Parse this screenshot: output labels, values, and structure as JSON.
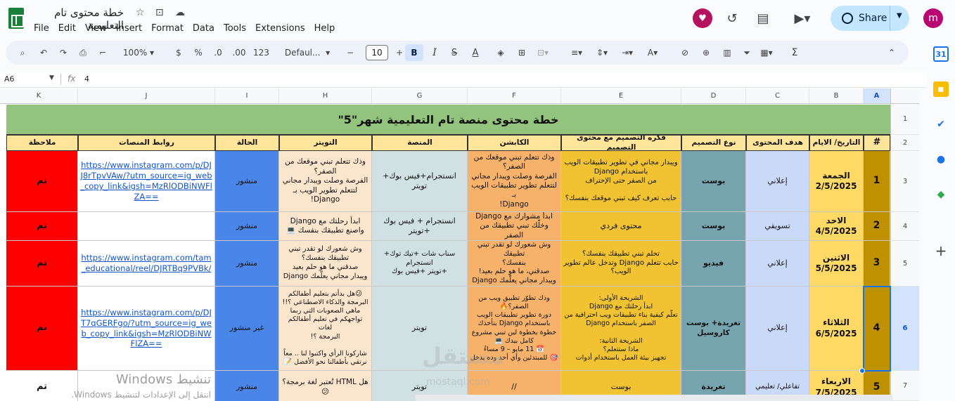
{
  "app": {
    "doc_title": "خطة محتوى تام التعليمية",
    "menu": [
      "File",
      "Edit",
      "View",
      "Insert",
      "Format",
      "Data",
      "Tools",
      "Extensions",
      "Help"
    ],
    "share_label": "Share",
    "avatar_letter": "m"
  },
  "toolbar": {
    "zoom": "100%",
    "currency": "$",
    "percent": "%",
    "dec_less": ".0",
    "dec_more": ".00",
    "number_format": "123",
    "font": "Defaul...",
    "font_size": "10",
    "bold": "B",
    "italic": "I",
    "strike": "S",
    "text_color": "A",
    "sum": "Σ"
  },
  "formula_bar": {
    "cell_ref": "A6",
    "fx": "fx",
    "value": "4"
  },
  "columns": [
    "K",
    "J",
    "I",
    "H",
    "G",
    "F",
    "E",
    "D",
    "C",
    "B",
    "A"
  ],
  "selected_column": "A",
  "row_numbers": [
    "1",
    "2",
    "3",
    "4",
    "5",
    "6",
    "7"
  ],
  "selected_row": "6",
  "sheet": {
    "banner": "خطة محتوى منصة تام التعليمية شهر\"5\"",
    "headers": {
      "A": "#",
      "B": "التاريخ/ الايام",
      "C": "هدف المحتوى",
      "D": "نوع التصميم",
      "E": "فكره التصميم مع محتوى التصميم",
      "F": "الكابشن",
      "G": "المنصة",
      "H": "التويتر",
      "I": "الحالة",
      "J": "روابط المنصات",
      "K": "ملاحظة"
    },
    "rows": [
      {
        "A": "1",
        "B": "الجمعة\n2/5/2025",
        "C": "إعلاني",
        "D": "بوست",
        "E": "ويبدار مجاني في تطوير تطبيقات الويب\nباستخدام Django\nمن الصفر حتى الإحتراف\n\nحابب تعرف كيف تبني موقعك بنفسك؟",
        "F": "وذك تتعلم تبني موقعك من\nالصفر؟\nالفرصة وصلت ويبدار مجاني\nلتتعلم تطوير تطبيقات الويب بـ\nDjango!",
        "G": "انستجرام+فيس بوك+ تويتر",
        "H": "وذك تتعلم تبني موقعك من\nالصفر؟\nالفرصة وصلت ويبدار مجاني\nلتتعلم تطوير الويب بـ\nDjango!",
        "I": "منشور",
        "J": "https://www.instagram.com/p/DJJ8rTpvVAw/?utm_source=ig_web_copy_link&igsh=MzRlODBiNWFlZA==",
        "K": "تم"
      },
      {
        "A": "2",
        "B": "الاحد\n4/5/2025",
        "C": "تسويقي",
        "D": "بوست",
        "E": "محتوى فردي",
        "F": "ابدأ مشوارك مع Django\nوخلّك تبني تطبيقك من الصفر",
        "G": "انستجرام + فيس بوك +تويتر",
        "H": "ابدأ رحلتك مع Django\nواصنع تطبيقك بنفسك 💻",
        "I": "منشور",
        "J": "",
        "K": "تم"
      },
      {
        "A": "3",
        "B": "الاثنين\n5/5/2025",
        "C": "إعلاني",
        "D": "فيديو",
        "E": "تحلم تبني تطبيقك بنفسك؟\nحابب تتعلم Django وتدخل عالم تطوير\nالويب؟",
        "F": "وش شعورك لو تقدر تبني تطبيقك\nبنفسك؟\nصدقني، ما هو حلم بعيد!\nويبدار مجاني يعلّمك Django",
        "G": "سناب شات +تيك توك+ انستجرام\n+تويتر +فيس بوك",
        "H": "وش شعورك لو تقدر تبني\nتطبيقك بنفسك؟\nصدقني ما هو حلم بعيد\nويبدار مجاني يعلّمك Django",
        "I": "منشور",
        "J": "https://www.instagram.com/tam_educational/reel/DJRTBq9PVBk/",
        "K": "تم"
      },
      {
        "A": "4",
        "B": "الثلاثاء\n6/5/2025",
        "C": "إعلاني",
        "D": "تغريدة+ بوست\nكاروسيل",
        "E": "الشريحة الأولى:\nابدأ رحلتك مع Django\nتعلّم كيفية بناء تطبيقات ويب احترافية من\nالصفر باستخدام Django\n\nالشريحة الثانية:\nماذا ستتعلم؟\nتجهيز بيئة العمل باستخدام أدوات",
        "F": "وذك تطوّر تطبيق ويب من\nالصفر؟🔥\nدورة تطوير تطبيقات الويب\nباستخدام Django بتأخذك\nخطوة بخطوة لين تبني مشروع\nكامل بيدك 💻\n📅 11 مايو – 9 مساءً\n🎯 للمبتدئين وأي أحد وده يدخل",
        "G": "تويتر",
        "H": "😕هل بدأتم بتعليم أطفالكم\nالبرمجة والذكاء الاصطناعي ؟!!\nماهي الصعوبات التي ربما\nتواجهكم في تعليم أطفالكم لغات\nالبرمجة ؟!\n\nشاركونا الرأي واكتبوا لنا .. معاً\nنرتقي بأطفالنا نحو الأفضل 📝",
        "I": "غير منشور",
        "J": "https://www.instagram.com/p/DJT7qGERFgo/?utm_source=ig_web_copy_link&igsh=MzRlODBiNWFlZA==",
        "K": "تم"
      },
      {
        "A": "5",
        "B": "الاربعاء\n7/5/2025",
        "C": "تفاعلي/ تعليمي",
        "D": "تغريدة",
        "E": "بوست",
        "F": "//",
        "G": "تويتر",
        "H": "هل HTML تُعتبر لغة برمجة؟\n😕",
        "I": "منشور",
        "J": "",
        "K": "تم"
      }
    ]
  },
  "watermarks": {
    "windows_title": "تنشيط Windows",
    "windows_sub": "انتقل إلى الإعدادات لتنشيط Windows.",
    "site_ar": "مستقل",
    "site_en": "mostaql.com"
  },
  "colors": {
    "banner": "#93c47d",
    "header_yellow": "#ffe599",
    "col_A": "#bf9000",
    "col_B": "#ffd966",
    "col_C": "#c9daf8",
    "col_D": "#76a5af",
    "col_E": "#f1c232",
    "col_F": "#f6b26b",
    "col_G": "#d0e0e3",
    "col_H": "#fce5cd",
    "col_I": "#4a86e8",
    "col_K": "#ff0000"
  }
}
